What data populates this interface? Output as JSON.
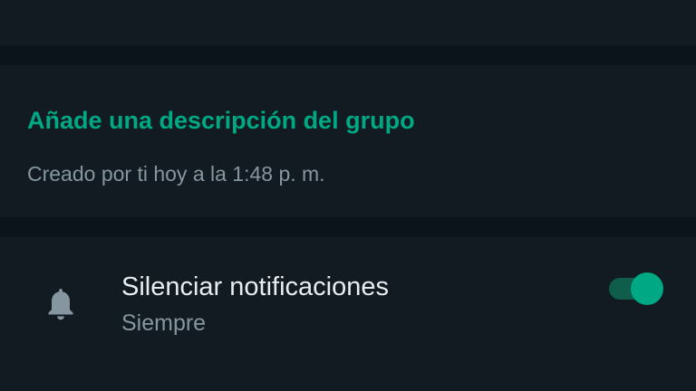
{
  "group_info": {
    "add_description_label": "Añade una descripción del grupo",
    "created_text": "Creado por ti hoy a la 1:48 p. m."
  },
  "mute_notifications": {
    "icon": "bell-icon",
    "title": "Silenciar notificaciones",
    "subtitle": "Siempre",
    "toggle_on": true
  },
  "colors": {
    "background": "#111b21",
    "divider": "#0b141a",
    "accent": "#00a884",
    "primary_text": "#e9edef",
    "secondary_text": "#8696a0",
    "toggle_track": "#0f5e4b"
  }
}
